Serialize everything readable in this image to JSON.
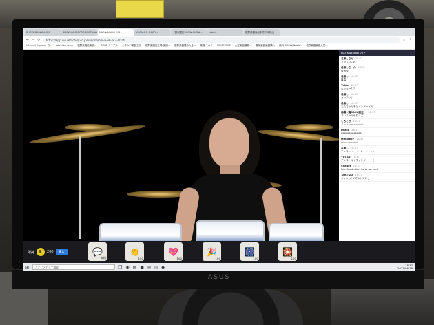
{
  "browser": {
    "tabs": [
      "SHOW-SHOWROOM",
      "SHOW-ROOM-PRODUCTS/NAONA",
      "NAONAYAOKI 2021",
      "VOCALOS・NAVY -",
      "【週末限定SHOW-SHOW...",
      "Labels",
      "岩野楽器商品手作り中検出"
    ],
    "active_tab": 2,
    "url": "https://app.visualfactory.co.jp/live/room/live-v8-0c3-0014",
    "bookmarks": [
      "Internet Explorer お...",
      "pochiden.com",
      "岩野楽器店楽器...",
      "T-CAT シリアル",
      "ミネルバ楽器工房",
      "岩野楽器加工場-楽器...",
      "岩野楽器展示大全...",
      "楽器 モルテ",
      "HOMEPAGE",
      "大型楽器通販...",
      "趣味楽器楽器購入",
      "無料 SHOW(NAVA...",
      "岩野楽器楽器大型..."
    ]
  },
  "chat": {
    "header": "NAONAYAOKI 2021",
    "messages": [
      {
        "name": "名無しさん",
        "time": "18:37",
        "text": "ドラムいいわ"
      },
      {
        "name": "名無しさーん",
        "time": "18:37",
        "text": "ｗｗｗ"
      },
      {
        "name": "名無し",
        "time": "18:37",
        "text": "最高"
      },
      {
        "name": "Yukie",
        "time": "18:37",
        "text": "キッキー！？"
      },
      {
        "name": "名無し",
        "time": "18:37",
        "text": "カッコいい"
      },
      {
        "name": "名無し",
        "time": "18:37",
        "text": "たたちゃんをとインペーイル"
      },
      {
        "name": "高橋（魔SAKU魔先）",
        "time": "18:37",
        "text": "アンコールやりハズ！"
      },
      {
        "name": "しろとき",
        "time": "18:37",
        "text": "ｆｏｏｏｏｏ〜〜〜"
      },
      {
        "name": "Imako",
        "time": "18:37",
        "text": "8888888888888"
      },
      {
        "name": "Minhre67",
        "time": "18:37",
        "text": "ｗ〜〜〜〜〜〜"
      },
      {
        "name": "名無し",
        "time": "18:37",
        "text": "アンコ〜〜〜〜〜♪〜〜〜〜〜"
      },
      {
        "name": "YUTAN",
        "time": "18:37",
        "text": "アンコールヤヴァンジー！！！"
      },
      {
        "name": "Shades",
        "time": "18:37",
        "text": "Ikan frustration hurts so much"
      },
      {
        "name": "TAKE-ZO",
        "time": "18:37",
        "text": "ジャレっ！♪ギルトアドゥ"
      }
    ]
  },
  "bottom_bar": {
    "balance_label": "所持",
    "coin_symbol": "L",
    "coin_amount": "200",
    "buy_label": "購入",
    "gifts": [
      {
        "icon": "💬",
        "name": "comment-gift",
        "points": "無料"
      },
      {
        "icon": "👏",
        "name": "clap-gift",
        "points": "100"
      },
      {
        "icon": "💖",
        "name": "heart-gift",
        "points": "100"
      },
      {
        "icon": "🎉",
        "name": "party-gift",
        "points": "100"
      },
      {
        "icon": "🎆",
        "name": "firework-gift",
        "points": "100"
      },
      {
        "icon": "🎇",
        "name": "sparkle-gift",
        "points": "100"
      }
    ]
  },
  "taskbar": {
    "search_placeholder": "ここに入力して検索",
    "time": "18:37",
    "date": "2021/06/19"
  },
  "monitor_brand": "ASUS",
  "colors": {
    "accent": "#2d7bdc",
    "coin": "#e6c81e",
    "chat_header": "#2b2b40"
  }
}
